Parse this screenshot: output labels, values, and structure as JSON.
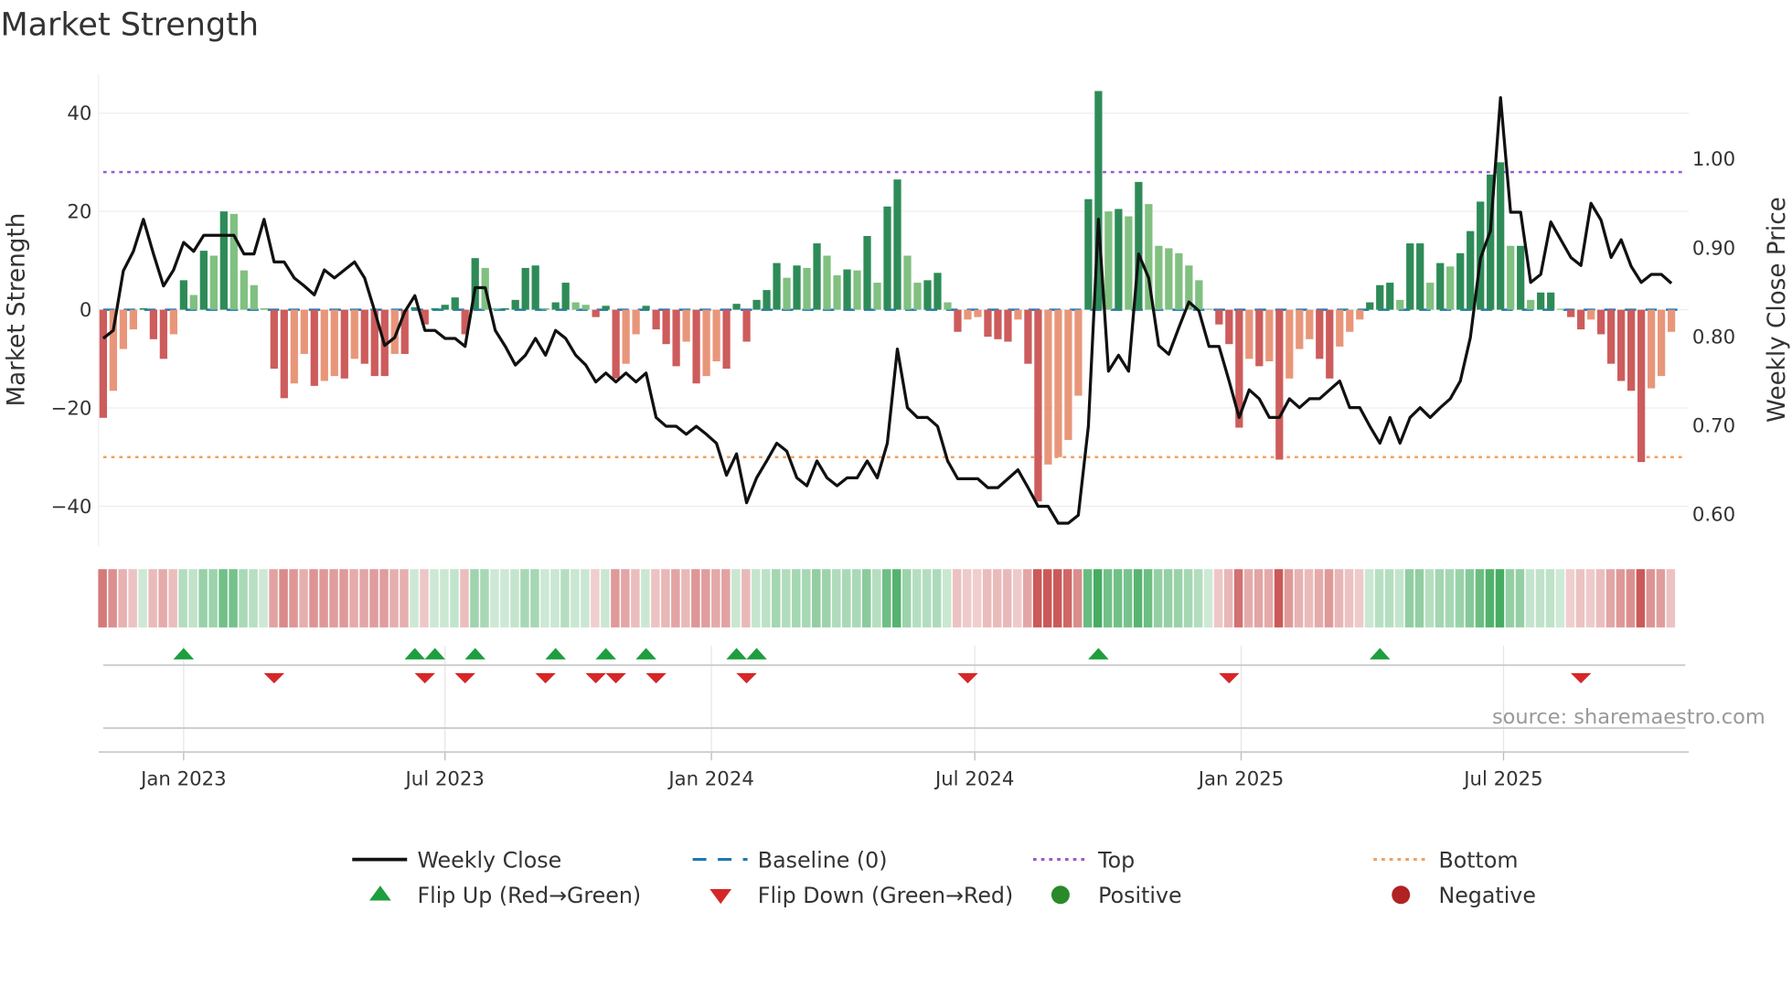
{
  "title": "Market Strength",
  "source": "source: sharemaestro.com",
  "colors": {
    "pos_strong": "#2e8b57",
    "pos_weak": "#80c080",
    "neg_strong": "#cd5c5c",
    "neg_weak": "#e8967a",
    "price": "#111111",
    "baseline": "#1f77b4",
    "top": "#9b59d0",
    "bottom": "#f0a060",
    "flip_up": "#1e9e3e",
    "flip_down": "#d62728",
    "positive": "#2a8a2a",
    "negative": "#b22222"
  },
  "chart_data": {
    "type": "bar",
    "title": "Market Strength",
    "ylabel": "Market Strength",
    "y2label": "Weekly Close Price",
    "ylim": [
      -48,
      48
    ],
    "y2lim": [
      0.56,
      1.12
    ],
    "yticks": [
      40,
      20,
      0,
      -20,
      -40
    ],
    "yticklabels": [
      "40",
      "20",
      "0",
      "−20",
      "−40"
    ],
    "y2ticks": [
      1.0,
      0.9,
      0.8,
      0.7,
      0.6
    ],
    "y2ticklabels": [
      "1.00",
      "0.90",
      "0.80",
      "0.70",
      "0.60"
    ],
    "x_unit": "week index",
    "xticks": [
      8,
      34,
      60.5,
      86.7,
      113.2,
      139.3
    ],
    "xticklabels": [
      "Jan 2023",
      "Jul 2023",
      "Jan 2024",
      "Jul 2024",
      "Jan 2025",
      "Jul 2025"
    ],
    "top_level": 28,
    "bottom_level": -30,
    "baseline": 0,
    "strength": [
      -22,
      -16.5,
      -8,
      -4,
      0.3,
      -6,
      -10,
      -5,
      6,
      3,
      12,
      11,
      20,
      19.5,
      8,
      5,
      0.3,
      -12,
      -18,
      -15,
      -9,
      -15.5,
      -14.5,
      -13.5,
      -14,
      -10,
      -11,
      -13.5,
      -13.5,
      -9,
      -9,
      0.5,
      -3,
      0.3,
      1,
      2.5,
      -5,
      10.5,
      8.5,
      0.3,
      0.3,
      2,
      8.5,
      9,
      0.3,
      1.5,
      5.5,
      1.5,
      1,
      -1.5,
      0.8,
      -14,
      -11,
      -5,
      0.8,
      -4,
      -7,
      -11.5,
      -6.5,
      -15,
      -13.5,
      -10.5,
      -12,
      1.2,
      -6.5,
      2,
      4,
      9.5,
      6.5,
      9,
      8.5,
      13.5,
      11,
      7,
      8.2,
      8,
      15,
      5.5,
      21,
      26.5,
      11,
      5.5,
      6,
      7.5,
      1.5,
      -4.5,
      -2,
      -1.5,
      -5.5,
      -6,
      -6.5,
      -2,
      -11,
      -39,
      -31.5,
      -30,
      -26.5,
      -17.5,
      22.5,
      44.5,
      20,
      20.5,
      19,
      26,
      21.5,
      13,
      12.5,
      11.5,
      9,
      6,
      0.2,
      -3,
      -7,
      -24,
      -10,
      -11.5,
      -10.5,
      -30.5,
      -14,
      -8,
      -6,
      -10,
      -14,
      -7.5,
      -4.5,
      -2,
      1.5,
      5,
      5.5,
      2,
      13.5,
      13.5,
      5.5,
      9.5,
      8.8,
      11.5,
      16,
      22,
      27.5,
      30,
      13,
      13,
      2,
      3.5,
      3.5,
      0.2,
      -1.5,
      -4,
      -2,
      -5,
      -11,
      -14.5,
      -16.5,
      -31,
      -16,
      -13.5,
      -4.5
    ],
    "weekly_close": [
      0.798,
      0.807,
      0.874,
      0.896,
      0.932,
      0.893,
      0.857,
      0.875,
      0.906,
      0.896,
      0.914,
      0.914,
      0.914,
      0.914,
      0.893,
      0.893,
      0.932,
      0.884,
      0.884,
      0.866,
      0.857,
      0.847,
      0.875,
      0.866,
      0.875,
      0.884,
      0.866,
      0.829,
      0.79,
      0.799,
      0.828,
      0.846,
      0.807,
      0.807,
      0.798,
      0.798,
      0.789,
      0.855,
      0.855,
      0.807,
      0.789,
      0.768,
      0.779,
      0.798,
      0.779,
      0.807,
      0.798,
      0.779,
      0.768,
      0.749,
      0.759,
      0.749,
      0.759,
      0.749,
      0.759,
      0.709,
      0.699,
      0.699,
      0.69,
      0.699,
      0.69,
      0.68,
      0.644,
      0.668,
      0.613,
      0.641,
      0.66,
      0.68,
      0.671,
      0.641,
      0.632,
      0.66,
      0.641,
      0.632,
      0.641,
      0.641,
      0.66,
      0.641,
      0.68,
      0.786,
      0.72,
      0.709,
      0.709,
      0.699,
      0.66,
      0.64,
      0.64,
      0.64,
      0.63,
      0.63,
      0.64,
      0.65,
      0.63,
      0.609,
      0.609,
      0.59,
      0.59,
      0.599,
      0.699,
      0.932,
      0.761,
      0.779,
      0.761,
      0.893,
      0.866,
      0.79,
      0.78,
      0.81,
      0.839,
      0.829,
      0.789,
      0.789,
      0.75,
      0.709,
      0.74,
      0.73,
      0.709,
      0.709,
      0.73,
      0.72,
      0.73,
      0.73,
      0.74,
      0.75,
      0.72,
      0.72,
      0.699,
      0.68,
      0.709,
      0.68,
      0.709,
      0.72,
      0.709,
      0.72,
      0.73,
      0.75,
      0.799,
      0.888,
      0.919,
      1.069,
      0.94,
      0.94,
      0.861,
      0.87,
      0.929,
      0.909,
      0.889,
      0.88,
      0.95,
      0.931,
      0.889,
      0.909,
      0.879,
      0.861,
      0.87,
      0.87,
      0.86
    ],
    "flip_up_weeks": [
      8,
      31,
      33,
      37,
      45,
      50,
      54,
      63,
      65,
      99,
      127
    ],
    "flip_down_weeks": [
      17,
      32,
      36,
      44,
      49,
      51,
      55,
      64,
      86,
      112,
      147
    ],
    "legend": {
      "placement": "bottom",
      "items": [
        {
          "label": "Weekly Close",
          "kind": "line"
        },
        {
          "label": "Baseline (0)",
          "kind": "dash"
        },
        {
          "label": "Top",
          "kind": "dot-purple"
        },
        {
          "label": "Bottom",
          "kind": "dot-orange"
        },
        {
          "label": "Flip Up (Red→Green)",
          "kind": "tri-up"
        },
        {
          "label": "Flip Down (Green→Red)",
          "kind": "tri-down"
        },
        {
          "label": "Positive",
          "kind": "circle-green"
        },
        {
          "label": "Negative",
          "kind": "circle-red"
        }
      ]
    }
  }
}
